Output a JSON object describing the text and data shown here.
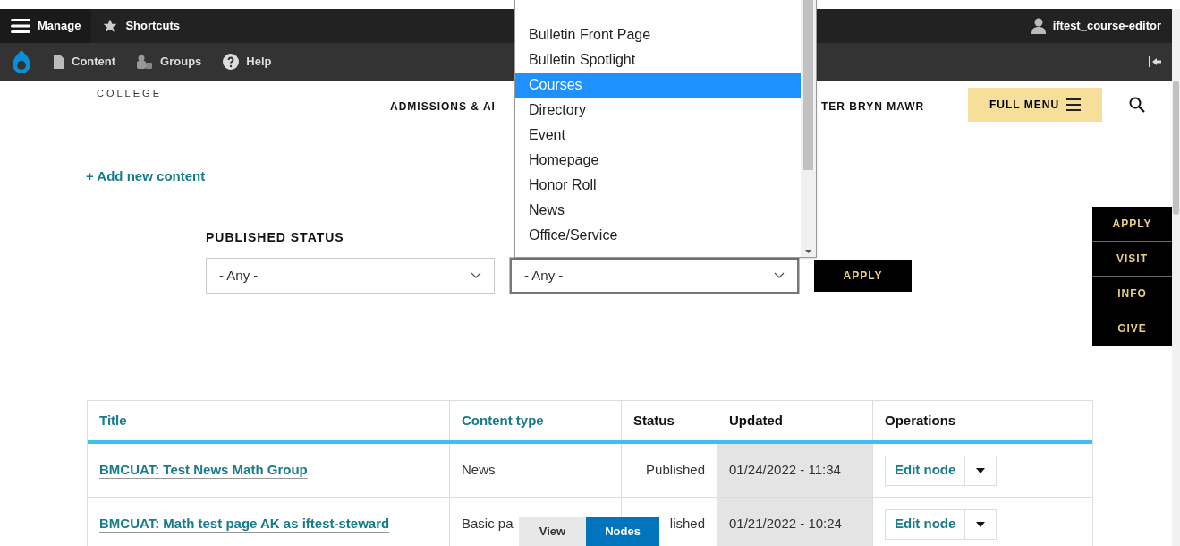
{
  "toolbar": {
    "manage": "Manage",
    "shortcuts": "Shortcuts",
    "user": "iftest_course-editor",
    "items": [
      "Content",
      "Groups",
      "Help"
    ]
  },
  "site": {
    "logo_text": "COLLEGE",
    "nav": [
      "ADMISSIONS & AI",
      "TER BRYN MAWR"
    ],
    "full_menu": "FULL MENU"
  },
  "add_link": "+ Add new content",
  "filters": [
    {
      "label": "PUBLISHED STATUS",
      "value": "- Any -",
      "focused": false
    },
    {
      "value": "- Any -",
      "focused": true
    }
  ],
  "apply": "APPLY",
  "dropdown": [
    {
      "label": "Bulletin Front Page",
      "selected": false
    },
    {
      "label": "Bulletin Spotlight",
      "selected": false
    },
    {
      "label": "Courses",
      "selected": true
    },
    {
      "label": "Directory",
      "selected": false
    },
    {
      "label": "Event",
      "selected": false
    },
    {
      "label": "Homepage",
      "selected": false
    },
    {
      "label": "Honor Roll",
      "selected": false
    },
    {
      "label": "News",
      "selected": false
    },
    {
      "label": "Office/Service",
      "selected": false
    }
  ],
  "side_buttons": [
    "APPLY",
    "VISIT",
    "INFO",
    "GIVE"
  ],
  "table": {
    "columns": [
      {
        "label": "Title",
        "sortable": true
      },
      {
        "label": "Content type",
        "sortable": true
      },
      {
        "label": "Status",
        "sortable": false
      },
      {
        "label": "Updated",
        "sortable": false
      },
      {
        "label": "Operations",
        "sortable": false
      }
    ],
    "rows": [
      {
        "title": "BMCUAT: Test News Math Group",
        "type": "News",
        "status": "Published",
        "updated": "01/24/2022 - 11:34",
        "operation": "Edit node"
      },
      {
        "title": "BMCUAT: Math test page AK as iftest-steward",
        "type": "Basic pa",
        "status": "lished",
        "updated": "01/21/2022 - 10:24",
        "operation": "Edit node"
      }
    ]
  },
  "tab_bar": [
    {
      "label": "View",
      "selected": false
    },
    {
      "label": "Nodes",
      "selected": true
    }
  ]
}
